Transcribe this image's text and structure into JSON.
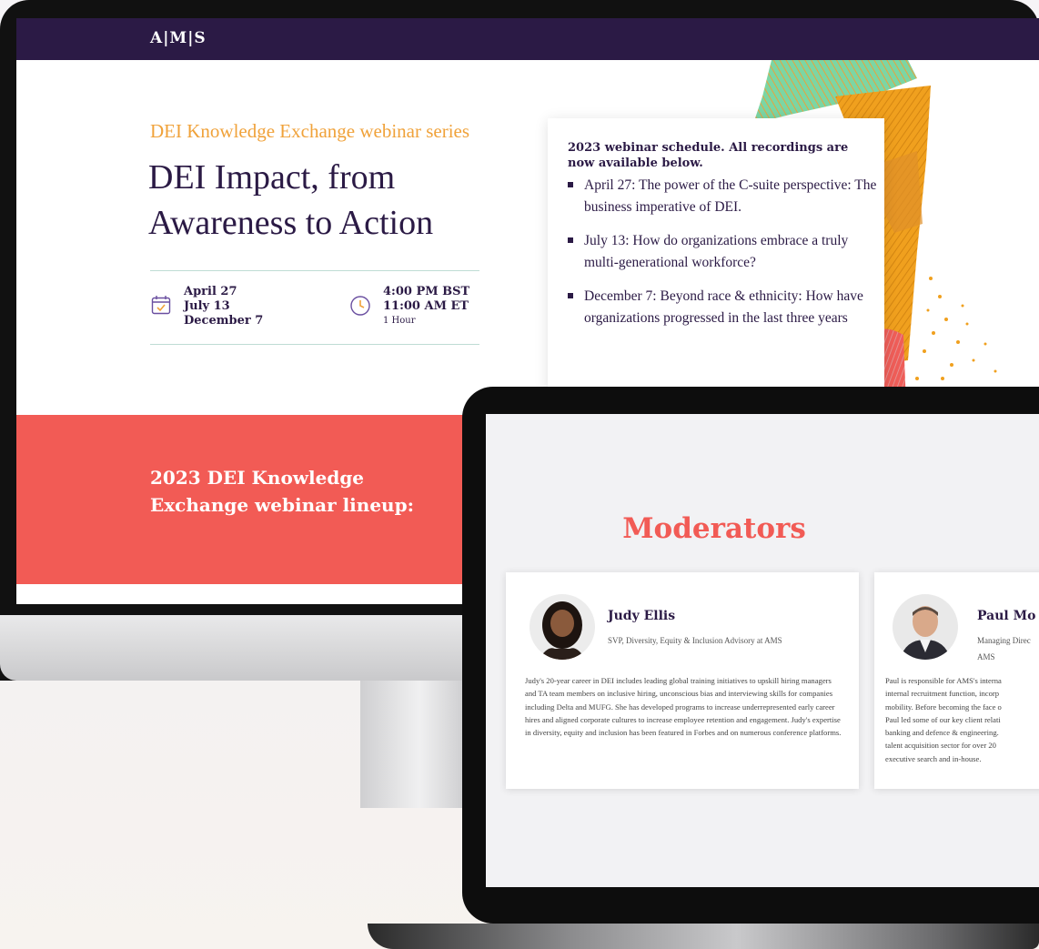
{
  "desktop": {
    "logo": "A|M|S",
    "series_label": "DEI Knowledge Exchange webinar series",
    "title": "DEI Impact, from Awareness to Action",
    "dates": [
      "April 27",
      "July 13",
      "December 7"
    ],
    "times": [
      "4:00 PM BST",
      "11:00 AM ET"
    ],
    "duration": "1 Hour",
    "schedule": {
      "title": "2023 webinar schedule. All recordings are now available below.",
      "items": [
        "April 27: The power of the C-suite perspective: The business imperative of DEI.",
        "July 13: How do organizations embrace a truly multi-generational workforce?",
        "December 7: Beyond race & ethnicity:  How have organizations progressed in the last three years"
      ]
    },
    "lineup_heading": [
      "2023 DEI Knowledge",
      "Exchange webinar lineup:"
    ],
    "colors": {
      "navy": "#2b1a45",
      "orange": "#f0a23a",
      "coral": "#f25b55"
    }
  },
  "laptop": {
    "heading": "Moderators",
    "moderators": [
      {
        "name": "Judy Ellis",
        "role": "SVP, Diversity, Equity & Inclusion Advisory at AMS",
        "bio": "Judy's 20-year career in DEI includes leading global training initiatives to upskill hiring managers and TA team members on inclusive hiring, unconscious bias and interviewing skills for companies including Delta and MUFG. She has developed programs to increase underrepresented early career hires and aligned corporate cultures to increase employee retention and engagement. Judy's expertise in diversity, equity and inclusion has been featured in Forbes and on numerous conference platforms."
      },
      {
        "name": "Paul Mo",
        "role_lines": [
          "Managing Direc",
          "AMS"
        ],
        "bio_lines": [
          "Paul is responsible for AMS's interna",
          "internal recruitment function, incorp",
          "mobility. Before becoming the face o",
          "Paul led some of our key client relati",
          "banking and defence & engineering.",
          "talent acquisition sector for over 20",
          "executive search and in-house."
        ]
      }
    ]
  }
}
